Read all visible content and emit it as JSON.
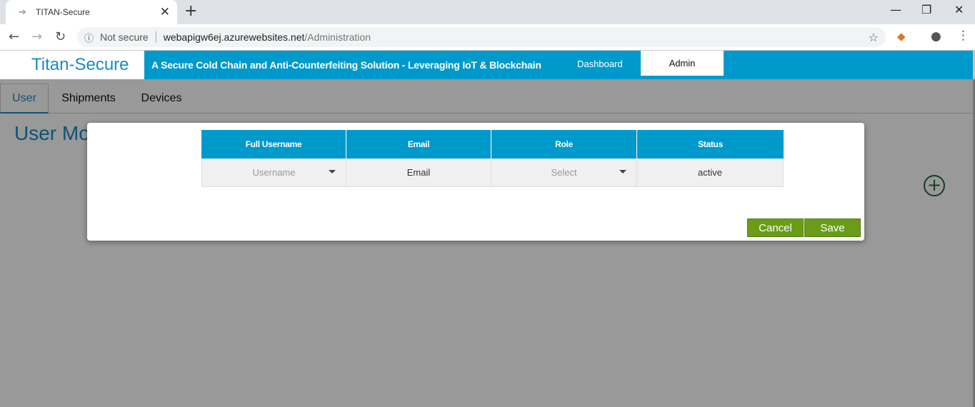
{
  "browser": {
    "tab_title": "TITAN-Secure",
    "tab_favicon": "arrow-icon",
    "security_label": "Not secure",
    "url_host": "webapigw6ej.azurewebsites.net",
    "url_path": "/Administration"
  },
  "app": {
    "brand": "Titan-Secure",
    "tagline": "A Secure Cold Chain and Anti-Counterfeiting Solution - Leveraging IoT & Blockchain",
    "nav": {
      "dashboard": "Dashboard",
      "admin": "Admin"
    },
    "subtabs": [
      "User",
      "Shipments",
      "Devices"
    ],
    "active_subtab": "User",
    "page_title": "User Mo",
    "colors": {
      "header": "#0099cc",
      "brand": "#1a8bc4",
      "button": "#6a9c1a"
    }
  },
  "modal": {
    "columns": [
      "Full Username",
      "Email",
      "Role",
      "Status"
    ],
    "row": {
      "username_placeholder": "Username",
      "email_placeholder": "Email",
      "role_placeholder": "Select",
      "status": "active"
    },
    "cancel_label": "Cancel",
    "save_label": "Save"
  }
}
